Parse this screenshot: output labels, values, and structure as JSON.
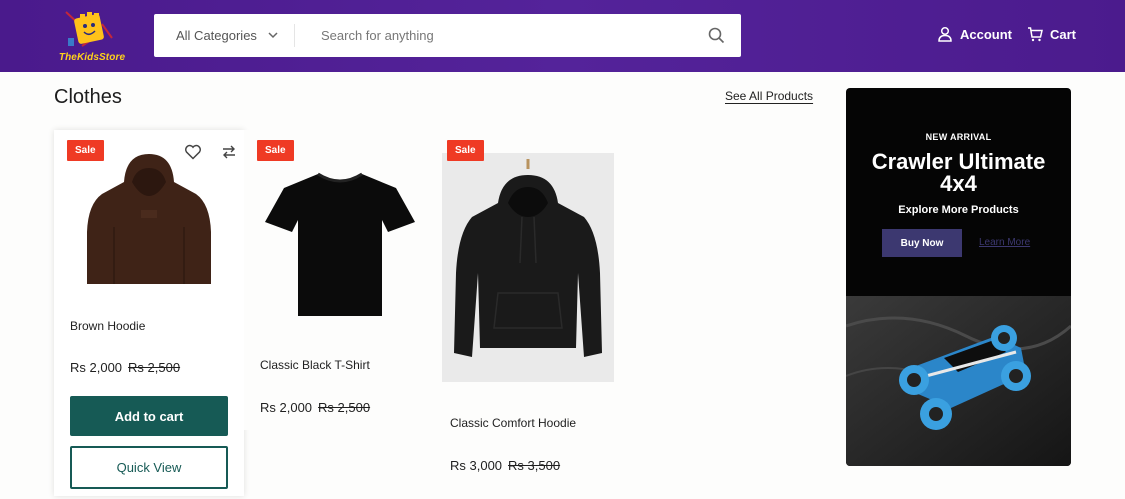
{
  "header": {
    "logo_text": "TheKidsStore",
    "category_label": "All Categories",
    "search_placeholder": "Search for anything",
    "account_label": "Account",
    "cart_label": "Cart"
  },
  "section": {
    "title": "Clothes",
    "see_all_label": "See All Products"
  },
  "products": [
    {
      "badge": "Sale",
      "name": "Brown Hoodie",
      "price": "Rs 2,000",
      "old_price": "Rs 2,500",
      "add_to_cart": "Add to cart",
      "quick_view": "Quick View"
    },
    {
      "badge": "Sale",
      "name": "Classic Black T-Shirt",
      "price": "Rs 2,000",
      "old_price": "Rs 2,500"
    },
    {
      "badge": "Sale",
      "name": "Classic Comfort Hoodie",
      "price": "Rs 3,000",
      "old_price": "Rs 3,500"
    }
  ],
  "banner": {
    "eyebrow": "NEW ARRIVAL",
    "title_line1": "Crawler Ultimate",
    "title_line2": "4x4",
    "subtitle": "Explore More Products",
    "buy_label": "Buy Now",
    "learn_label": "Learn More"
  },
  "colors": {
    "header": "#4c1c8e",
    "sale_badge": "#ef3a24",
    "primary_button": "#165a55",
    "banner_button": "#3c3870"
  }
}
